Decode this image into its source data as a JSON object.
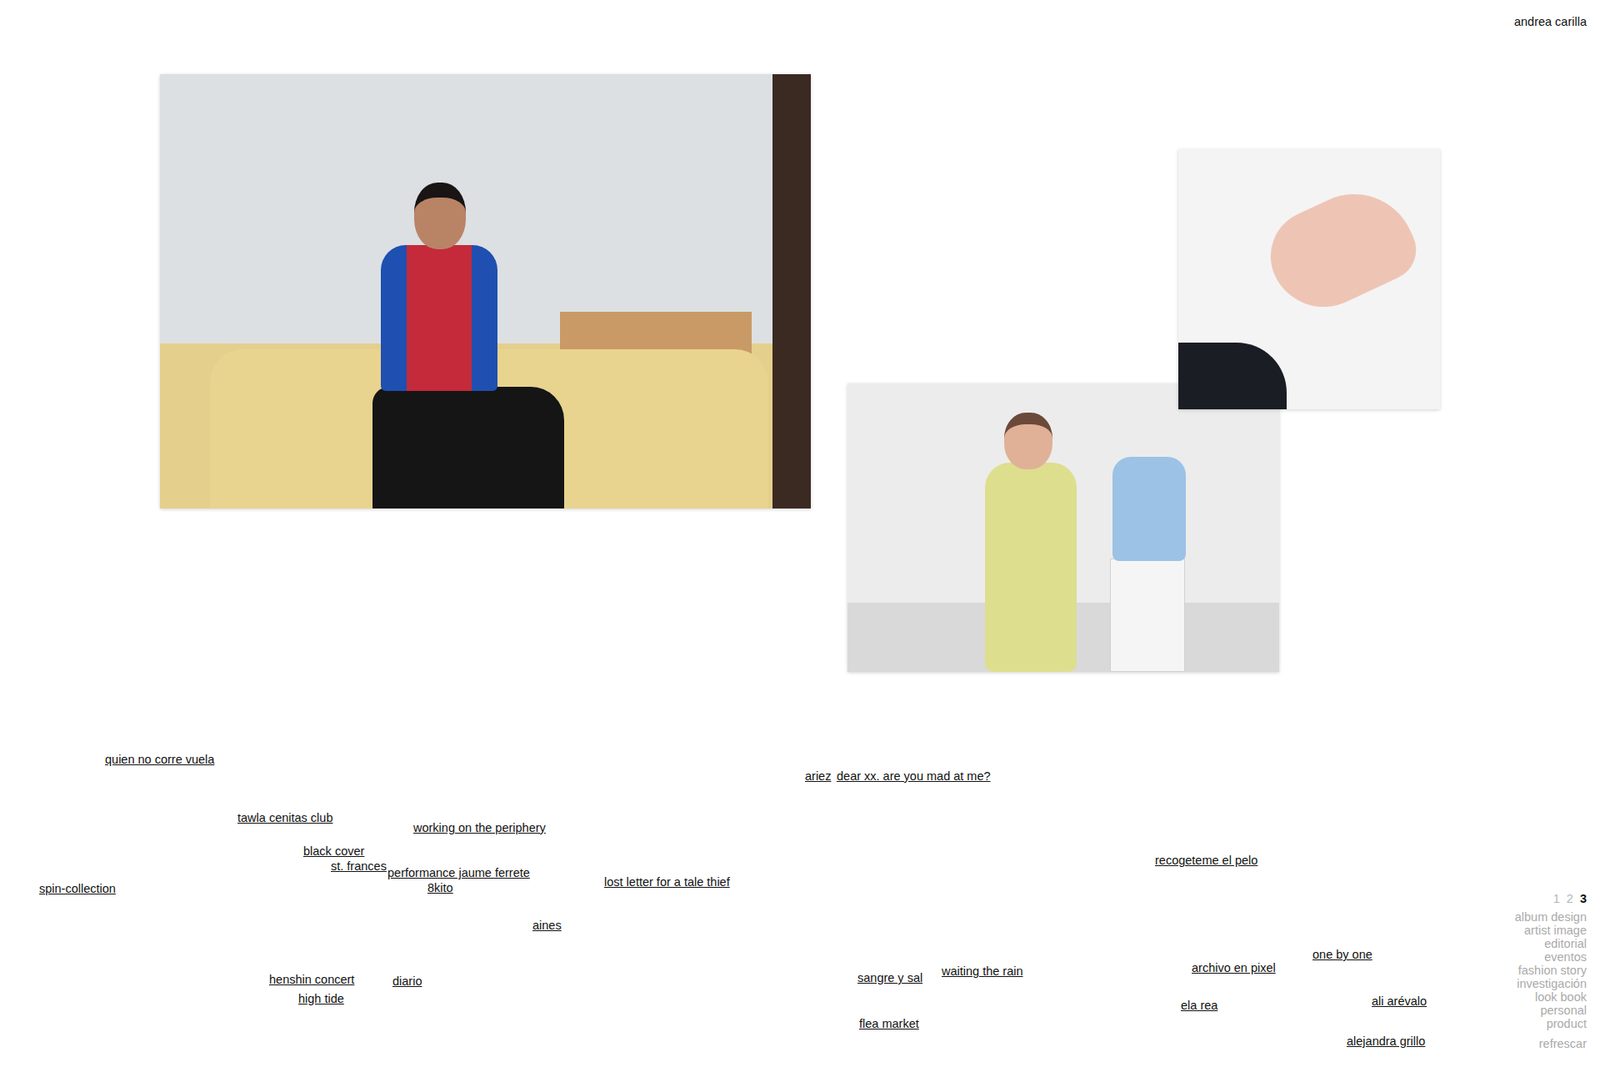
{
  "header": {
    "name": "andrea carilla"
  },
  "projects": [
    {
      "label": "quien no corre vuela"
    },
    {
      "label": "tawla cenitas club"
    },
    {
      "label": "working on the periphery"
    },
    {
      "label": "black cover"
    },
    {
      "label": "st. frances"
    },
    {
      "label": "performance jaume ferrete"
    },
    {
      "label": "8kito"
    },
    {
      "label": "spin-collection"
    },
    {
      "label": "lost letter for a tale thief"
    },
    {
      "label": "aines"
    },
    {
      "label": "henshin concert"
    },
    {
      "label": "diario"
    },
    {
      "label": "high tide"
    },
    {
      "label": "ariez"
    },
    {
      "label": "dear xx. are you mad at me?"
    },
    {
      "label": "recogeteme el pelo"
    },
    {
      "label": "sangre y sal"
    },
    {
      "label": "waiting the rain"
    },
    {
      "label": "flea market"
    },
    {
      "label": "archivo en pixel"
    },
    {
      "label": "one by one"
    },
    {
      "label": "ela rea"
    },
    {
      "label": "ali arévalo"
    },
    {
      "label": "alejandra grillo"
    }
  ],
  "pagination": [
    {
      "label": "1",
      "selected": false
    },
    {
      "label": "2",
      "selected": false
    },
    {
      "label": "3",
      "selected": true
    }
  ],
  "categories": [
    "album design",
    "artist image",
    "editorial",
    "eventos",
    "fashion story",
    "investigación",
    "look book",
    "personal",
    "product"
  ],
  "refresh": "refrescar"
}
